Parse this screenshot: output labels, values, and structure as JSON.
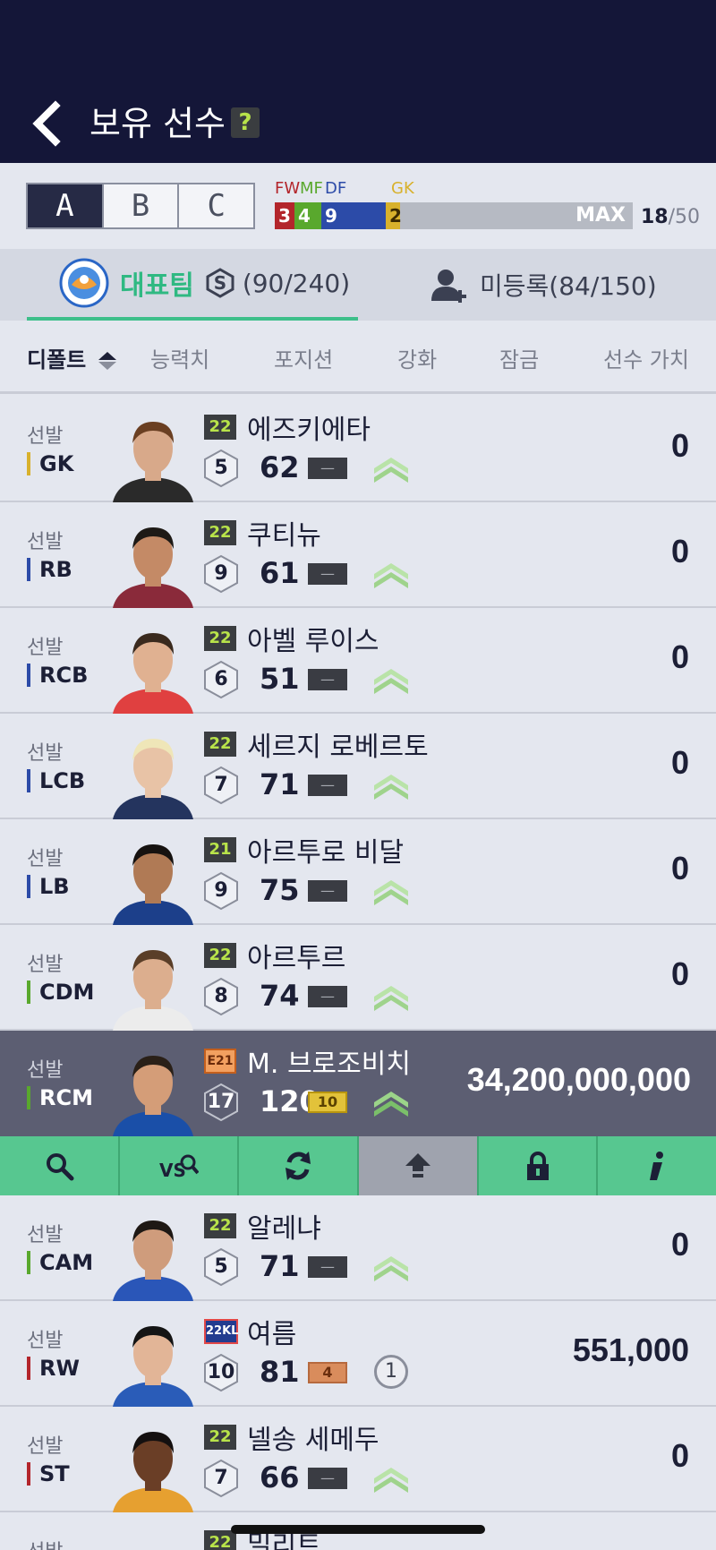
{
  "header": {
    "title": "보유 선수",
    "help": "?"
  },
  "squads": {
    "tabs": [
      "A",
      "B",
      "C"
    ],
    "active": "A"
  },
  "position_summary": {
    "labels": [
      "FW",
      "MF",
      "DF",
      "GK"
    ],
    "counts": [
      "3",
      "4",
      "9",
      "2"
    ],
    "colors": {
      "FW": "#b3252b",
      "MF": "#59a82d",
      "DF": "#2c4ba8",
      "GK": "#d8b12c"
    },
    "max_label": "MAX",
    "current": "18",
    "max": "/50"
  },
  "team_tabs": {
    "representative_label": "대표팀",
    "representative_count": "(90/240)",
    "unregistered_label": "미등록(84/150)"
  },
  "sort": {
    "items": [
      "디폴트",
      "능력치",
      "포지션",
      "강화",
      "잠금",
      "선수 가치"
    ],
    "active": "디폴트"
  },
  "players": [
    {
      "starter": "선발",
      "position": "GK",
      "pos_color": "#d8b12c",
      "season": "22",
      "name": "에즈키에타",
      "pay": "5",
      "ovr": "62",
      "enhance": "—",
      "value": "0",
      "skin": "#d8a98a",
      "hair": "#6a3f22",
      "shirt": "#2a2a2a"
    },
    {
      "starter": "선발",
      "position": "RB",
      "pos_color": "#2c4ba8",
      "season": "22",
      "name": "쿠티뉴",
      "pay": "9",
      "ovr": "61",
      "enhance": "—",
      "value": "0",
      "skin": "#c48a66",
      "hair": "#1e1a16",
      "shirt": "#8a2a3a"
    },
    {
      "starter": "선발",
      "position": "RCB",
      "pos_color": "#2c4ba8",
      "season": "22",
      "name": "아벨 루이스",
      "pay": "6",
      "ovr": "51",
      "enhance": "—",
      "value": "0",
      "skin": "#e0b191",
      "hair": "#3a2a1e",
      "shirt": "#e04040"
    },
    {
      "starter": "선발",
      "position": "LCB",
      "pos_color": "#2c4ba8",
      "season": "22",
      "name": "세르지 로베르토",
      "pay": "7",
      "ovr": "71",
      "enhance": "—",
      "value": "0",
      "skin": "#e8c3a6",
      "hair": "#efe6b8",
      "shirt": "#24345e"
    },
    {
      "starter": "선발",
      "position": "LB",
      "pos_color": "#2c4ba8",
      "season": "21",
      "name": "아르투로 비달",
      "pay": "9",
      "ovr": "75",
      "enhance": "—",
      "value": "0",
      "skin": "#b07a55",
      "hair": "#161210",
      "shirt": "#1c3f8a"
    },
    {
      "starter": "선발",
      "position": "CDM",
      "pos_color": "#59a82d",
      "season": "22",
      "name": "아르투르",
      "pay": "8",
      "ovr": "74",
      "enhance": "—",
      "value": "0",
      "skin": "#dcae8e",
      "hair": "#5a3e28",
      "shirt": "#ececec"
    },
    {
      "starter": "선발",
      "position": "RCM",
      "pos_color": "#59a82d",
      "season": "E21",
      "name": "M. 브로조비치",
      "pay": "17",
      "ovr": "120",
      "enhance": "10",
      "value": "34,200,000,000",
      "skin": "#d49d78",
      "hair": "#2a2018",
      "shirt": "#1a4fa8"
    },
    {
      "starter": "선발",
      "position": "CAM",
      "pos_color": "#59a82d",
      "season": "22",
      "name": "알레냐",
      "pay": "5",
      "ovr": "71",
      "enhance": "—",
      "value": "0",
      "skin": "#cf9c7c",
      "hair": "#1e1814",
      "shirt": "#2a56b8"
    },
    {
      "starter": "선발",
      "position": "RW",
      "pos_color": "#b3252b",
      "season": "22KL",
      "name": "여름",
      "pay": "10",
      "ovr": "81",
      "enhance": "4",
      "count": "1",
      "value": "551,000",
      "skin": "#e2b597",
      "hair": "#141414",
      "shirt": "#2a5cb8"
    },
    {
      "starter": "선발",
      "position": "ST",
      "pos_color": "#b3252b",
      "season": "22",
      "name": "넬송 세메두",
      "pay": "7",
      "ovr": "66",
      "enhance": "—",
      "value": "0",
      "skin": "#6a3e26",
      "hair": "#141010",
      "shirt": "#e6a030"
    }
  ],
  "partial_row": {
    "starter": "선발",
    "season": "22",
    "name": "밀리트"
  },
  "action_bar": [
    "search-icon",
    "versus-icon",
    "swap-icon",
    "upload-icon",
    "lock-icon",
    "info-icon"
  ]
}
